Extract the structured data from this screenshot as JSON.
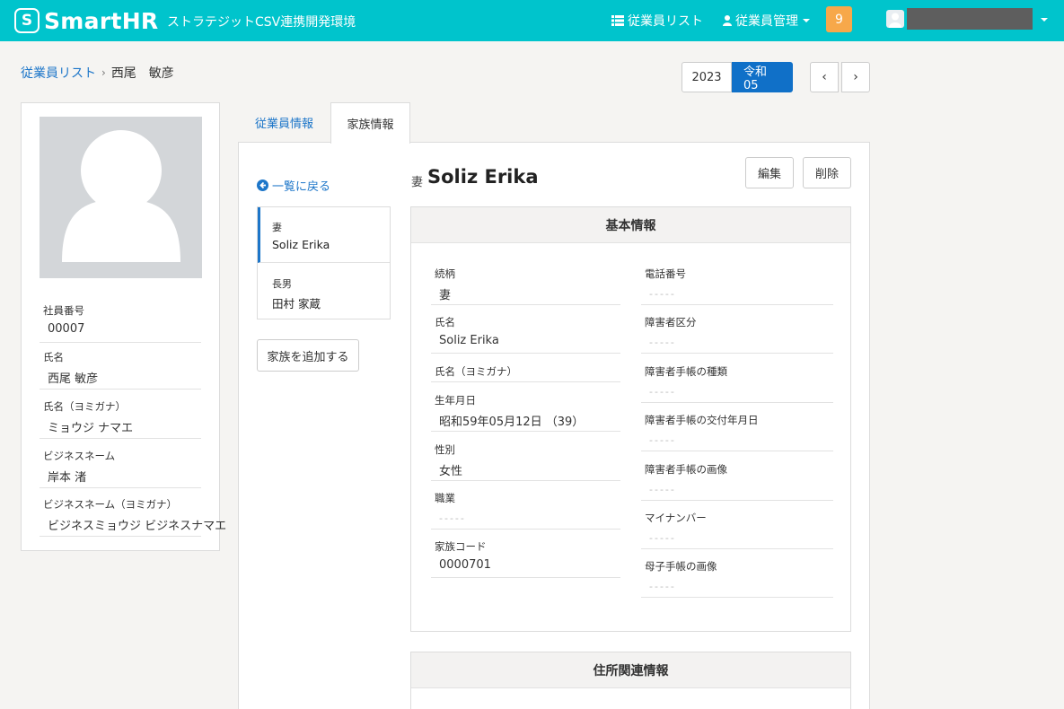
{
  "header": {
    "logo_mark": "S",
    "logo_text": "SmartHR",
    "env_name": "ストラテジットCSV連携開発環境",
    "nav_employee_list": "従業員リスト",
    "nav_employee_manage": "従業員管理",
    "notification_count": "9",
    "accent_color": "#00c4cc"
  },
  "breadcrumb": {
    "link": "従業員リスト",
    "separator": "›",
    "current": "西尾　敏彦"
  },
  "year_switch": {
    "western": "2023",
    "japanese": "令和05",
    "prev": "‹",
    "next": "›"
  },
  "profile": {
    "fields": [
      {
        "label": "社員番号",
        "value": "00007"
      },
      {
        "label": "氏名",
        "value": "西尾 敏彦"
      },
      {
        "label": "氏名（ヨミガナ）",
        "value": "ミョウジ ナマエ"
      },
      {
        "label": "ビジネスネーム",
        "value": "岸本 渚"
      },
      {
        "label": "ビジネスネーム（ヨミガナ）",
        "value": "ビジネスミョウジ ビジネスナマエ"
      }
    ]
  },
  "tabs": {
    "employee_info": "従業員情報",
    "family_info": "家族情報"
  },
  "family": {
    "back_label": "一覧に戻る",
    "members": [
      {
        "relation": "妻",
        "name": "Soliz Erika"
      },
      {
        "relation": "長男",
        "name": "田村 家蔵"
      }
    ],
    "add_label": "家族を追加する"
  },
  "detail": {
    "relation": "妻",
    "name": "Soliz Erika",
    "edit_label": "編集",
    "delete_label": "削除"
  },
  "basic_info": {
    "title": "基本情報",
    "left": [
      {
        "label": "続柄",
        "value": "妻"
      },
      {
        "label": "氏名",
        "value": "Soliz Erika"
      },
      {
        "label": "氏名（ヨミガナ）",
        "value": ""
      },
      {
        "label": "生年月日",
        "value": "昭和59年05月12日 （39）"
      },
      {
        "label": "性別",
        "value": "女性"
      },
      {
        "label": "職業",
        "value": "-----"
      },
      {
        "label": "家族コード",
        "value": "0000701"
      }
    ],
    "right": [
      {
        "label": "電話番号",
        "value": "-----"
      },
      {
        "label": "障害者区分",
        "value": "-----"
      },
      {
        "label": "障害者手帳の種類",
        "value": "-----"
      },
      {
        "label": "障害者手帳の交付年月日",
        "value": "-----"
      },
      {
        "label": "障害者手帳の画像",
        "value": "-----"
      },
      {
        "label": "マイナンバー",
        "value": "-----"
      },
      {
        "label": "母子手帳の画像",
        "value": "-----"
      }
    ]
  },
  "address_info": {
    "title": "住所関連情報"
  }
}
